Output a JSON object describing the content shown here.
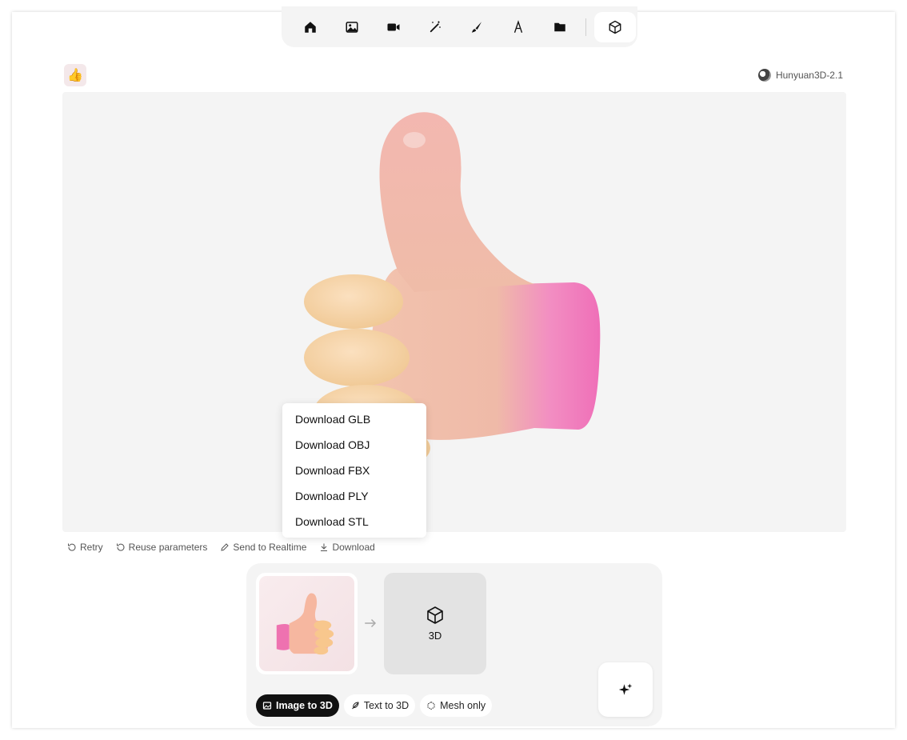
{
  "toolbar": {
    "tools": [
      {
        "icon": "home-icon"
      },
      {
        "icon": "image-icon"
      },
      {
        "icon": "video-icon"
      },
      {
        "icon": "magic-wand-icon"
      },
      {
        "icon": "brush-icon"
      },
      {
        "icon": "font-icon"
      },
      {
        "icon": "folder-icon"
      },
      {
        "icon": "cube-icon",
        "active": true
      }
    ]
  },
  "header": {
    "avatar_emoji": "👍",
    "model_name": "Hunyuan3D-2.1"
  },
  "download_menu": {
    "items": [
      "Download GLB",
      "Download OBJ",
      "Download FBX",
      "Download PLY",
      "Download STL"
    ]
  },
  "actions": {
    "retry": "Retry",
    "reuse": "Reuse parameters",
    "send": "Send to Realtime",
    "download": "Download"
  },
  "panel": {
    "target_label": "3D",
    "modes": [
      {
        "label": "Image to 3D",
        "active": true
      },
      {
        "label": "Text to 3D",
        "active": false
      },
      {
        "label": "Mesh only",
        "active": false
      }
    ]
  },
  "colors": {
    "accent": "#111111",
    "viewer_bg": "#f4f4f4",
    "panel_bg": "#f4f4f4"
  }
}
